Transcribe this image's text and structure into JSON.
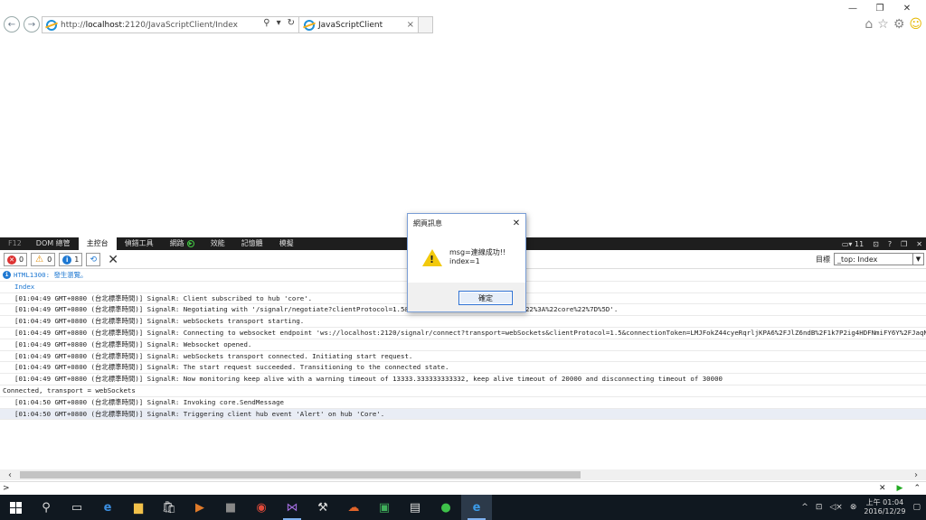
{
  "browser": {
    "url_prefix": "http://",
    "url_host": "localhost",
    "url_rest": ":2120/JavaScriptClient/Index",
    "tab_title": "JavaScriptClient",
    "tab_close": "×"
  },
  "devtools": {
    "f12_label": "F12",
    "tabs": [
      "DOM 總管",
      "主控台",
      "偵錯工具",
      "網路",
      "效能",
      "記憶體",
      "模擬"
    ],
    "screen_count": "11",
    "error_count": "0",
    "warning_count": "0",
    "info_count": "1",
    "target_label": "目標",
    "target_value": "_top: Index",
    "console_rows": [
      {
        "type": "info",
        "text": "HTML1300: 發生瀏覽。"
      },
      {
        "type": "link",
        "text": "Index"
      },
      {
        "type": "log",
        "text": "[01:04:49 GMT+0800 (台北標準時間)] SignalR: Client subscribed to hub 'core'."
      },
      {
        "type": "log",
        "text": "[01:04:49 GMT+0800 (台北標準時間)] SignalR: Negotiating with '/signalr/negotiate?clientProtocol=1.5&connectionData=%5B%7B%22name%22%3A%22core%22%7D%5D'."
      },
      {
        "type": "log",
        "text": "[01:04:49 GMT+0800 (台北標準時間)] SignalR: webSockets transport starting."
      },
      {
        "type": "log",
        "text": "[01:04:49 GMT+0800 (台北標準時間)] SignalR: Connecting to websocket endpoint 'ws://localhost:2120/signalr/connect?transport=webSockets&clientProtocol=1.5&connectionToken=LMJFokZ44cyeRqrljKPA6%2FJlZ6ndB%2F1k7P2ig4HDFNmiFY6Y%2FJaqNt"
      },
      {
        "type": "log",
        "text": "[01:04:49 GMT+0800 (台北標準時間)] SignalR: Websocket opened."
      },
      {
        "type": "log",
        "text": "[01:04:49 GMT+0800 (台北標準時間)] SignalR: webSockets transport connected. Initiating start request."
      },
      {
        "type": "log",
        "text": "[01:04:49 GMT+0800 (台北標準時間)] SignalR: The start request succeeded. Transitioning to the connected state."
      },
      {
        "type": "log",
        "text": "[01:04:49 GMT+0800 (台北標準時間)] SignalR: Now monitoring keep alive with a warning timeout of 13333.333333333332, keep alive timeout of 20000 and disconnecting timeout of 30000"
      },
      {
        "type": "plain",
        "text": "Connected, transport = webSockets"
      },
      {
        "type": "log",
        "text": "[01:04:50 GMT+0800 (台北標準時間)] SignalR: Invoking core.SendMessage"
      },
      {
        "type": "highlight",
        "text": "[01:04:50 GMT+0800 (台北標準時間)] SignalR: Triggering client hub event 'Alert' on hub 'Core'."
      }
    ],
    "prompt": ">"
  },
  "dialog": {
    "title": "網頁訊息",
    "message_line1": "msg=連線成功!!",
    "message_line2": "index=1",
    "ok_label": "確定"
  },
  "taskbar": {
    "time": "上午 01:04",
    "date": "2016/12/29"
  }
}
